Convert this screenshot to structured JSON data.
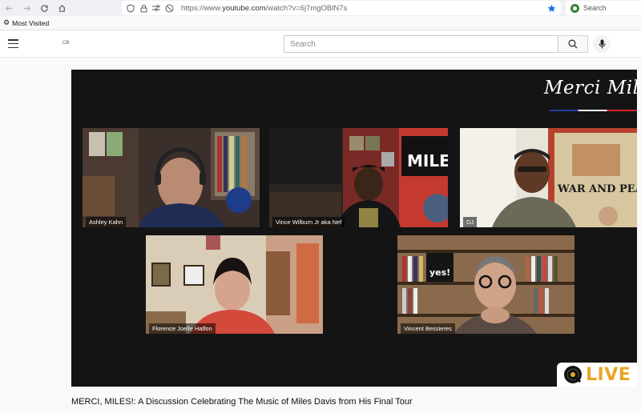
{
  "browser": {
    "url_prefix": "https://www.",
    "url_host": "youtube.com",
    "url_path": "/watch?v=6j7mgOBlN7s",
    "search_placeholder": "Search",
    "bookmark": "Most Visited"
  },
  "youtube": {
    "region_code": "CB",
    "search_placeholder": "Search"
  },
  "video": {
    "brand_text": "Merci Miles",
    "live_text": "LIVE",
    "title": "MERCI, MILES!: A Discussion Celebrating The Music of Miles Davis from His Final Tour",
    "participants": [
      {
        "name": "Ashley Kahn"
      },
      {
        "name": "Vince Wilburn Jr aka Nef"
      },
      {
        "name": "DJ"
      },
      {
        "name": "Florence Joelle Halfon"
      },
      {
        "name": "Vincent Bessieres"
      }
    ],
    "poster_text": "WAR AND PEACE",
    "sign_text": "MILE",
    "book_text": "yes!"
  },
  "colors": {
    "accent_blue": "#1a73e8",
    "live_orange": "#e8a623"
  }
}
